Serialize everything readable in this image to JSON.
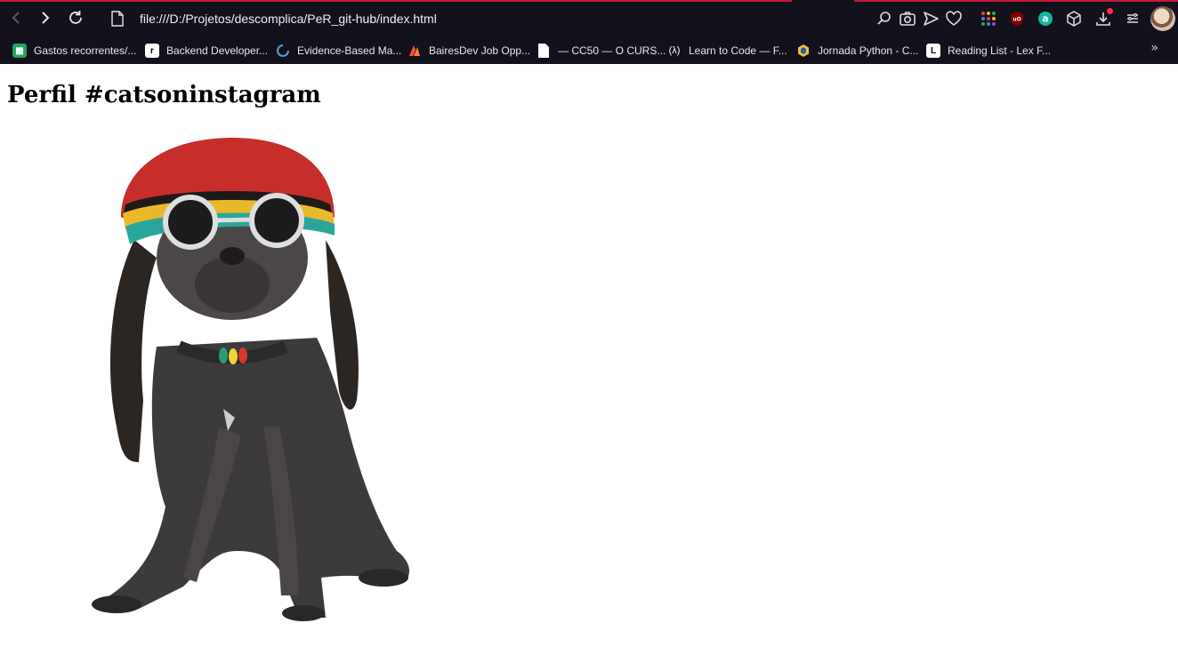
{
  "browser": {
    "url": "file:///D:/Projetos/descomplica/PeR_git-hub/index.html",
    "colors": {
      "chrome_bg": "#13111b",
      "active_tab_line": "#c2183a",
      "notify_dot": "#ff2a55"
    },
    "nav": {
      "back_icon": "chevron-left-icon",
      "forward_icon": "chevron-right-icon",
      "reload_icon": "reload-icon"
    },
    "toolbar_icons": [
      "search-icon",
      "camera-icon",
      "send-icon",
      "heart-icon",
      "apps-grid-icon",
      "ublock-icon",
      "extension-a-icon",
      "cube-icon",
      "download-icon",
      "menu-icon",
      "avatar"
    ]
  },
  "bookmarks": [
    {
      "label": "Gastos recorrentes/...",
      "icon": "sheets-icon"
    },
    {
      "label": "Backend Developer...",
      "icon": "r-logo-icon"
    },
    {
      "label": "Evidence-Based Ma...",
      "icon": "circle-logo-icon"
    },
    {
      "label": "BairesDev Job Opp...",
      "icon": "bairesdev-icon"
    },
    {
      "label": "— CC50 — O CURS...",
      "icon": "document-icon"
    },
    {
      "label": "Learn to Code — F...",
      "icon": "freecodecamp-icon"
    },
    {
      "label": "Jornada Python - C...",
      "icon": "python-hex-icon"
    },
    {
      "label": "Reading List - Lex F...",
      "icon": "l-logo-icon"
    }
  ],
  "bookmarks_more": "»",
  "page": {
    "heading": "Perfil #catsoninstagram",
    "image_subject": "dog-in-rasta-costume"
  }
}
